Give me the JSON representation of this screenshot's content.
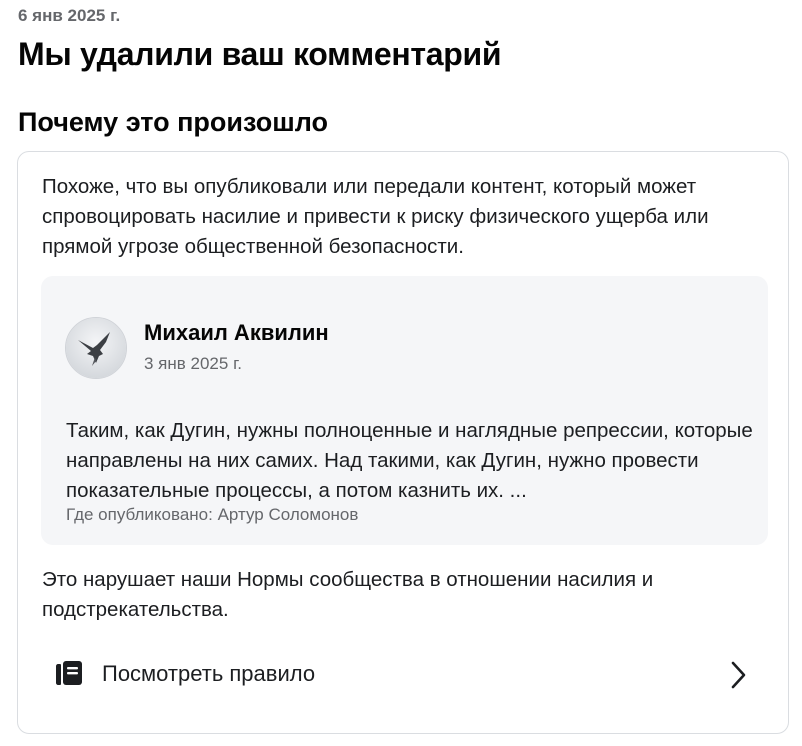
{
  "notice": {
    "date": "6 янв 2025 г.",
    "title": "Мы удалили ваш комментарий",
    "subtitle": "Почему это произошло"
  },
  "card": {
    "reason": "Похоже, что вы опубликовали или передали контент, который может спровоцировать насилие и привести к риску физического ущерба или прямой угрозе общественной безопасности.",
    "post": {
      "author": "Михаил Аквилин",
      "date": "3 янв 2025 г.",
      "text": "Таким, как Дугин, нужны полноценные и наглядные репрессии, которые направлены на них самих. Над такими, как Дугин, нужно провести показательные процессы, а потом казнить их. ...",
      "posted_where": "Где опубликовано: Артур Соломонов",
      "avatar_icon": "bird-photo-avatar"
    },
    "violation": "Это нарушает наши Нормы сообщества в отношении насилия и подстрекательства.",
    "rule_link": {
      "label": "Посмотреть правило",
      "icon": "rulebook-icon",
      "chevron_icon": "chevron-right-icon"
    }
  },
  "colors": {
    "text_primary": "#1c1e21",
    "text_secondary": "#65676b",
    "card_border": "#dadde1",
    "post_background": "#f5f6f8"
  }
}
